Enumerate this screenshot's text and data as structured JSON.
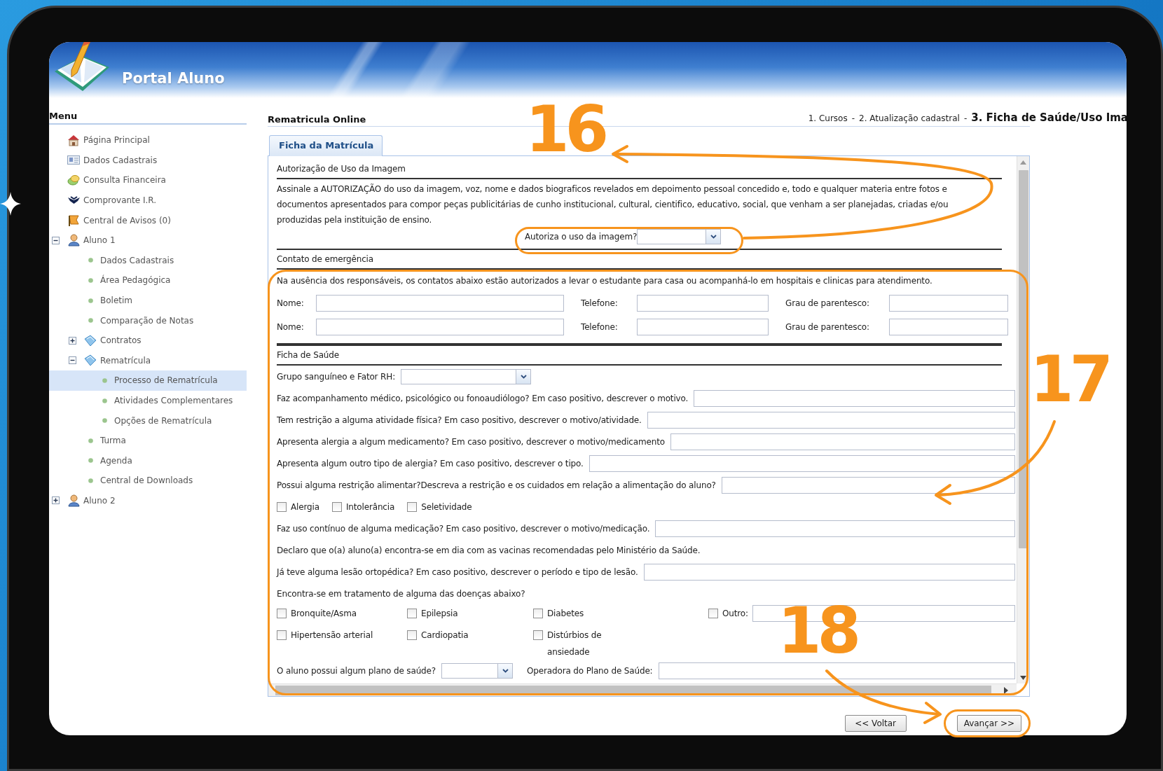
{
  "header": {
    "title": "Portal Aluno"
  },
  "menu": {
    "title": "Menu",
    "items": [
      {
        "label": "Página Principal",
        "kind": "house",
        "selected": false
      },
      {
        "label": "Dados Cadastrais",
        "kind": "card",
        "selected": false
      },
      {
        "label": "Consulta Financeira",
        "kind": "coins",
        "selected": false
      },
      {
        "label": "Comprovante I.R.",
        "kind": "emblem",
        "selected": false
      },
      {
        "label": "Central de Avisos (0)",
        "kind": "flag",
        "selected": false
      },
      {
        "label": "Aluno 1",
        "kind": "person",
        "selected": false,
        "expanded": true,
        "children": [
          {
            "label": "Dados Cadastrais",
            "kind": "bullet",
            "selected": false
          },
          {
            "label": "Área Pedagógica",
            "kind": "bullet",
            "selected": false
          },
          {
            "label": "Boletim",
            "kind": "bullet",
            "selected": false
          },
          {
            "label": "Comparação de Notas",
            "kind": "bullet",
            "selected": false
          },
          {
            "label": "Contratos",
            "kind": "book",
            "selected": false,
            "expanded": false
          },
          {
            "label": "Rematrícula",
            "kind": "book",
            "selected": false,
            "expanded": true,
            "children": [
              {
                "label": "Processo de Rematrícula",
                "kind": "bullet",
                "selected": true
              },
              {
                "label": "Atividades Complementares",
                "kind": "bullet",
                "selected": false
              },
              {
                "label": "Opções de Rematrícula",
                "kind": "bullet",
                "selected": false
              }
            ]
          },
          {
            "label": "Turma",
            "kind": "bullet",
            "selected": false
          },
          {
            "label": "Agenda",
            "kind": "bullet",
            "selected": false
          },
          {
            "label": "Central de Downloads",
            "kind": "bullet",
            "selected": false
          }
        ]
      },
      {
        "label": "Aluno 2",
        "kind": "person",
        "selected": false,
        "expanded": false
      }
    ]
  },
  "page_title": "Rematricula Online",
  "breadcrumb": {
    "separator": "-",
    "steps": [
      {
        "label": "1. Cursos",
        "current": false
      },
      {
        "label": "2. Atualização cadastral",
        "current": false
      },
      {
        "label": "3. Ficha de Saúde/Uso Ima",
        "current": true
      }
    ]
  },
  "tabs": [
    {
      "label": "Ficha da Matrícula",
      "selected": true
    }
  ],
  "form": [
    {
      "kind": "heading",
      "text": "Autorização de Uso da Imagem"
    },
    {
      "kind": "consent",
      "text": "Assinale a AUTORIZAÇÃO do uso da imagem, voz, nome e dados biograficos revelados em depoimento pessoal concedido e, todo e qualquer materia entre fotos e documentos apresentados para compor peças publicitárias de cunho institucional, cultural, cientifico, educativo, social, que venham a ser planejadas, criadas e/ou produzidas pela instituição de ensino.",
      "select_label": "Autoriza o uso da imagem?"
    },
    {
      "kind": "heading",
      "text": "Contato de emergência"
    },
    {
      "kind": "text",
      "text": "Na ausência dos responsáveis, os contatos abaixo estão autorizados a levar o estudante para casa ou acompanhá-lo em hospitais e clinicas para atendimento."
    },
    {
      "kind": "contact",
      "fields": [
        "Nome:",
        "Telefone:",
        "Grau de parentesco:"
      ]
    },
    {
      "kind": "contact",
      "fields": [
        "Nome:",
        "Telefone:",
        "Grau de parentesco:"
      ]
    },
    {
      "kind": "heading",
      "text": "Ficha de Saúde"
    },
    {
      "kind": "select",
      "label": "Grupo sanguíneo e Fator RH:"
    },
    {
      "kind": "question",
      "label": "Faz acompanhamento médico, psicológico ou fonoaudiólogo? Em caso positivo, descrever o motivo."
    },
    {
      "kind": "question",
      "label": "Tem restrição a alguma atividade física? Em caso positivo, descrever o motivo/atividade."
    },
    {
      "kind": "question",
      "label": "Apresenta alergia a algum medicamento? Em caso positivo, descrever o motivo/medicamento"
    },
    {
      "kind": "question",
      "label": "Apresenta algum outro tipo de alergia? Em caso positivo, descrever o tipo."
    },
    {
      "kind": "question",
      "label": "Possui alguma restrição alimentar?Descreva a restrição e os cuidados em relação a alimentação do aluno?"
    },
    {
      "kind": "checks",
      "options": [
        {
          "label": "Alergia",
          "checked": false
        },
        {
          "label": "Intolerância",
          "checked": false
        },
        {
          "label": "Seletividade",
          "checked": false
        }
      ]
    },
    {
      "kind": "question",
      "label": "Faz uso contínuo de alguma medicação? Em caso positivo, descrever o motivo/medicação."
    },
    {
      "kind": "text",
      "text": "Declaro que o(a) aluno(a) encontra-se em dia com as vacinas recomendadas pelo Ministério da Saúde."
    },
    {
      "kind": "question",
      "label": "Já teve alguma lesão ortopédica? Em caso positivo, descrever o período e tipo de lesão."
    },
    {
      "kind": "text",
      "text": "Encontra-se em tratamento de alguma das doenças abaixo?"
    },
    {
      "kind": "check_grid",
      "rows": [
        [
          {
            "kind": "checkbox",
            "label": "Bronquite/Asma",
            "checked": false
          },
          {
            "kind": "checkbox",
            "label": "Epilepsia",
            "checked": false
          },
          {
            "kind": "checkbox",
            "label": "Diabetes",
            "checked": false
          },
          {
            "kind": "checkbox_field",
            "label": "Outro:",
            "checked": false
          }
        ],
        [
          {
            "kind": "checkbox",
            "label": "Hipertensão arterial",
            "checked": false
          },
          {
            "kind": "checkbox",
            "label": "Cardiopatia",
            "checked": false
          },
          {
            "kind": "checkbox",
            "label": "Distúrbios de ansiedade",
            "checked": false
          }
        ]
      ]
    },
    {
      "kind": "select_field",
      "label": "O aluno possui algum plano de saúde?",
      "field_label": "Operadora do Plano de Saúde:"
    }
  ],
  "buttons": [
    {
      "label": "<< Voltar"
    },
    {
      "label": "Avançar >>"
    }
  ],
  "annotations": [
    {
      "label": "16"
    },
    {
      "label": "17"
    },
    {
      "label": "18"
    }
  ]
}
